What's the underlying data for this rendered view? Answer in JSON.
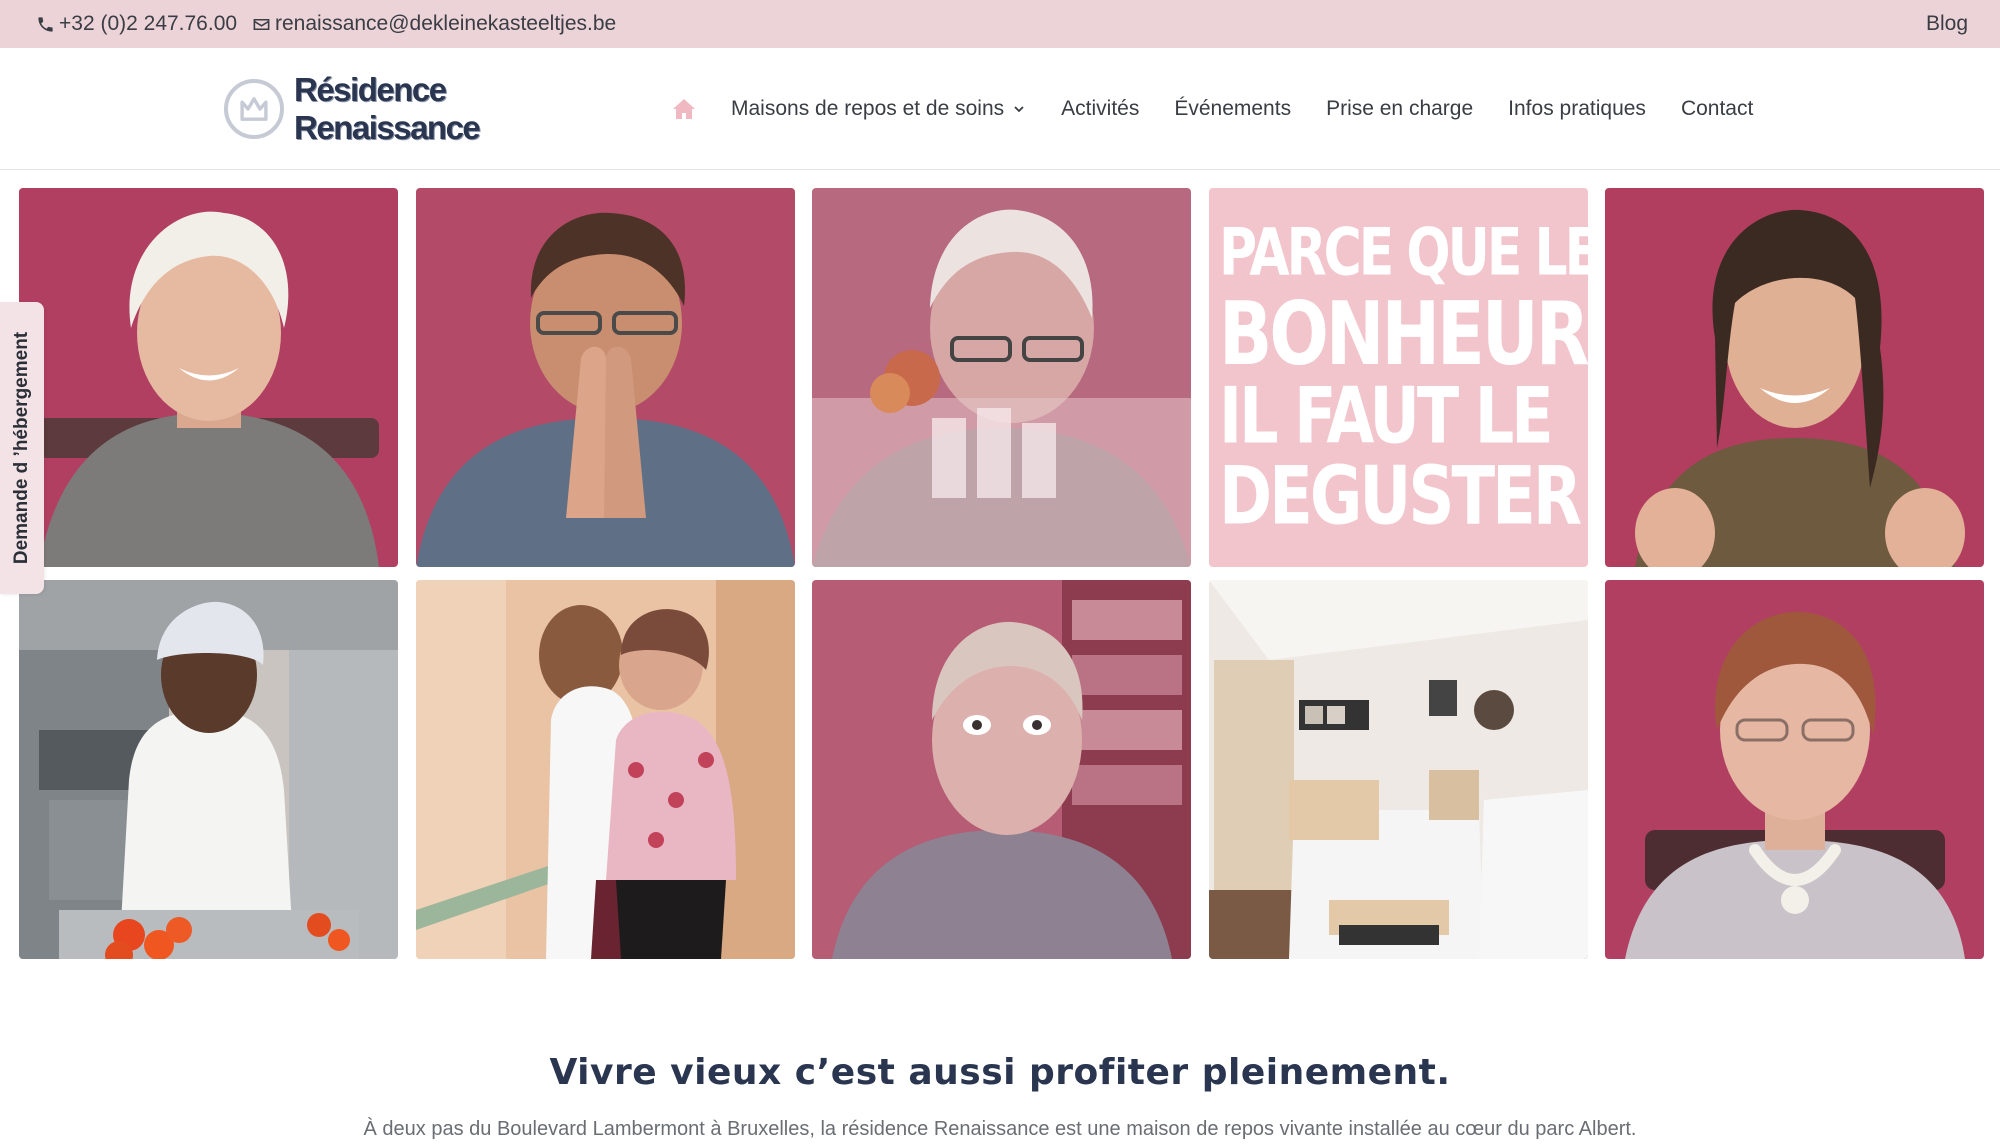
{
  "topbar": {
    "phone": "+32 (0)2 247.76.00",
    "email": "renaissance@dekleinekasteeltjes.be",
    "blog": "Blog"
  },
  "logo": {
    "line1": "Résidence",
    "line2": "Renaissance"
  },
  "nav": {
    "home_icon": "home-icon",
    "items": [
      {
        "label": "Maisons de repos et de soins",
        "has_dropdown": true
      },
      {
        "label": "Activités"
      },
      {
        "label": "Événements"
      },
      {
        "label": "Prise en charge"
      },
      {
        "label": "Infos pratiques"
      },
      {
        "label": "Contact"
      }
    ]
  },
  "sidetab": {
    "label": "Demande d ’hébergement"
  },
  "slogan": {
    "lines": [
      "PARCE QUE LE",
      "BONHEUR",
      "IL FAUT LE",
      "DEGUSTER"
    ]
  },
  "tiles": [
    {
      "content": "photo-elderly-woman-laughing"
    },
    {
      "content": "photo-man-hands-together"
    },
    {
      "content": "photo-man-with-glasses-and-table-setting"
    },
    {
      "content": "slogan"
    },
    {
      "content": "photo-young-woman-smiling"
    },
    {
      "content": "photo-cook-cutting-tomatoes"
    },
    {
      "content": "photo-caregiver-helping-resident"
    },
    {
      "content": "photo-elderly-man-with-bookshelf"
    },
    {
      "content": "photo-bedroom"
    },
    {
      "content": "photo-elderly-woman-necklace"
    }
  ],
  "intro": {
    "title": "Vivre vieux c’est aussi profiter pleinement.",
    "text": "À deux pas du Boulevard Lambermont à Bruxelles, la résidence Renaissance est une maison de repos vivante installée au cœur du parc Albert."
  },
  "colors": {
    "topbar_bg": "#ecd3d8",
    "accent_pink": "#f0b9c2",
    "photo_wall": "#b13f61",
    "slogan_bg": "#f2c5cc",
    "navy": "#2a3550"
  }
}
